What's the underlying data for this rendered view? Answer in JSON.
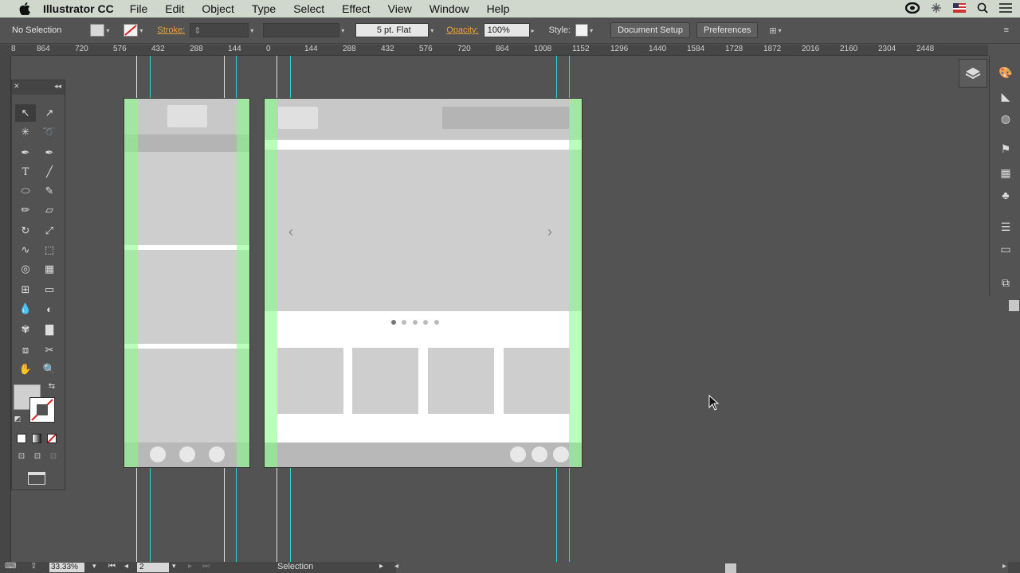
{
  "menubar": {
    "app_name": "Illustrator CC",
    "items": [
      "File",
      "Edit",
      "Object",
      "Type",
      "Select",
      "Effect",
      "View",
      "Window",
      "Help"
    ]
  },
  "control_bar": {
    "selection": "No Selection",
    "stroke_label": "Stroke:",
    "brush": "5 pt. Flat",
    "opacity_label": "Opacity:",
    "opacity_value": "100%",
    "style_label": "Style:",
    "document_setup": "Document Setup",
    "preferences": "Preferences"
  },
  "ruler_top": [
    "8",
    "864",
    "720",
    "576",
    "432",
    "288",
    "144",
    "0",
    "144",
    "288",
    "432",
    "576",
    "720",
    "864",
    "1008",
    "1152",
    "1296",
    "1440",
    "1584",
    "1728",
    "1872",
    "2016",
    "2160",
    "2304",
    "2448"
  ],
  "status_bar": {
    "zoom": "33.33%",
    "artboard": "2",
    "mode": "Selection"
  },
  "colors": {
    "guide": "#2fd6d6",
    "column": "#82ff82",
    "menubar_bg": "#d0d8ce",
    "accent_label": "#e8a23c"
  },
  "icons": [
    "apple-icon",
    "creative-cloud-icon",
    "wifi-icon",
    "flag-icon",
    "search-icon",
    "list-icon",
    "selection-tool-icon",
    "direct-selection-icon",
    "magic-wand-icon",
    "lasso-icon",
    "pen-icon",
    "curvature-icon",
    "type-icon",
    "line-icon",
    "ellipse-icon",
    "paintbrush-icon",
    "pencil-icon",
    "eraser-icon",
    "rotate-icon",
    "scale-icon",
    "warp-icon",
    "free-transform-icon",
    "shape-builder-icon",
    "perspective-icon",
    "mesh-icon",
    "gradient-icon",
    "eyedropper-icon",
    "blend-icon",
    "symbol-sprayer-icon",
    "graph-icon",
    "artboard-icon",
    "slice-icon",
    "hand-icon",
    "zoom-icon",
    "layers-icon",
    "color-icon",
    "brushes-icon",
    "appearance-icon",
    "libraries-icon",
    "swatches-icon",
    "symbols-icon",
    "align-icon",
    "gradient-panel-icon",
    "transform-icon"
  ]
}
